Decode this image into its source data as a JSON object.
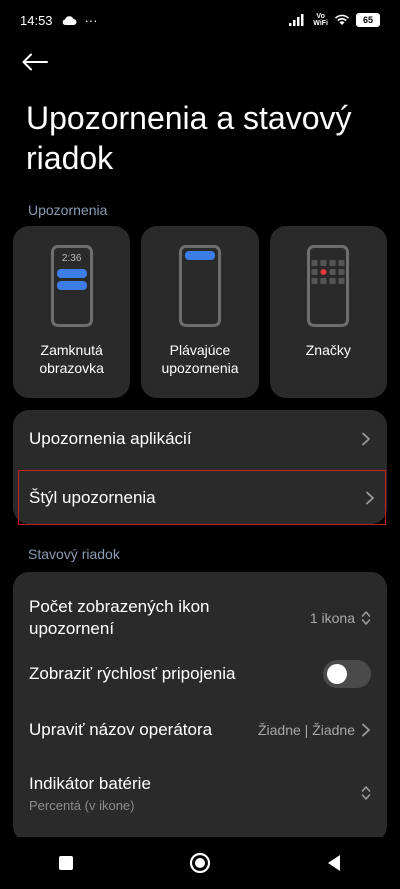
{
  "status_bar": {
    "time": "14:53",
    "dots": "···",
    "volte_top": "Vo",
    "volte_bottom": "WiFi",
    "battery": "65"
  },
  "page": {
    "title": "Upozornenia a stavový riadok"
  },
  "notifications_section": {
    "header": "Upozornenia",
    "cards": [
      {
        "label": "Zamknutá obrazovka",
        "preview_time": "2:36",
        "icon": "lock-screen-preview-icon"
      },
      {
        "label": "Plávajúce upozornenia",
        "icon": "floating-notification-preview-icon"
      },
      {
        "label": "Značky",
        "icon": "badges-preview-icon"
      }
    ],
    "rows": [
      {
        "title": "Upozornenia aplikácií"
      },
      {
        "title": "Štýl upozornenia"
      }
    ]
  },
  "status_section": {
    "header": "Stavový riadok",
    "rows": [
      {
        "title": "Počet zobrazených ikon upozornení",
        "value": "1 ikona"
      },
      {
        "title": "Zobraziť rýchlosť pripojenia",
        "toggle": false
      },
      {
        "title": "Upraviť názov operátora",
        "value": "Žiadne | Žiadne"
      },
      {
        "title": "Indikátor batérie",
        "subtitle": "Percentá (v ikone)"
      }
    ]
  },
  "colors": {
    "accent_blue": "#3d7ee6",
    "badge_red": "#e53935",
    "highlight_border": "#c81f1f",
    "card_bg": "#2a2a2a"
  }
}
